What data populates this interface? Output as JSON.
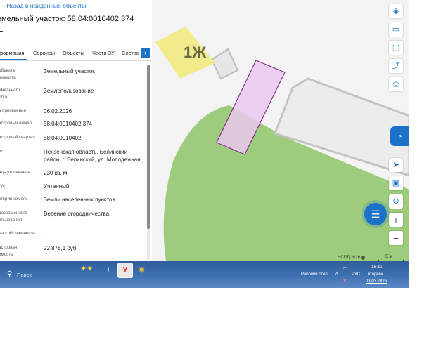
{
  "back_link": "Назад в найденные объекты",
  "title": "емельный участок: 58:04:0010402:374",
  "tabs": [
    "формация",
    "Сервисы",
    "Объекты",
    "Части ЗУ",
    "Состав"
  ],
  "tab_next_icon": "chevron-right-icon",
  "fields": [
    {
      "label": "объекта\nжимости",
      "value": "Земельный участок"
    },
    {
      "label": "емельного\nстка",
      "value": "Землепользование"
    },
    {
      "label": "а присвоения",
      "value": "06.02.2026"
    },
    {
      "label": "астровый номер",
      "value": "58:04:0010402:374"
    },
    {
      "label": "астровый квартал",
      "value": "58:04:0010402"
    },
    {
      "label": "ес",
      "value": "Пензенская область, Белинский район, г. Белинский, ул. Молодежная"
    },
    {
      "label": "адь уточненная",
      "value": "230 кв. м"
    },
    {
      "label": "тус",
      "value": "Учтенный"
    },
    {
      "label": "егория земель",
      "value": "Земли населенных пунктов"
    },
    {
      "label": "разрешенного\nользования",
      "value": "Ведение огородничества"
    },
    {
      "label": "ма собственности",
      "value": "-"
    },
    {
      "label": "астровая\nимость",
      "value": "22 878,1 руб."
    }
  ],
  "map": {
    "building_label": "1Ж",
    "copyright": "НСПД 2026",
    "scale": "5 м",
    "colors": {
      "parcel_fill": "#e9c8ec",
      "parcel_stroke": "#8a2c8f",
      "green_area": "#9ccc7c",
      "building": "#ececec",
      "label_bg": "#f1eb8c"
    },
    "buttons": [
      "layers-icon",
      "ruler-icon",
      "select-area-icon",
      "share-icon",
      "print-icon",
      "locate-icon",
      "map-type-icon",
      "geo-icon",
      "zoom-in-icon",
      "zoom-out-icon"
    ]
  },
  "taskbar": {
    "search_placeholder": "Поиск",
    "desktop_label": "Рабочий стол",
    "language": "РУС",
    "time": "16:11",
    "day": "вторник",
    "date": "03.03.2026"
  }
}
